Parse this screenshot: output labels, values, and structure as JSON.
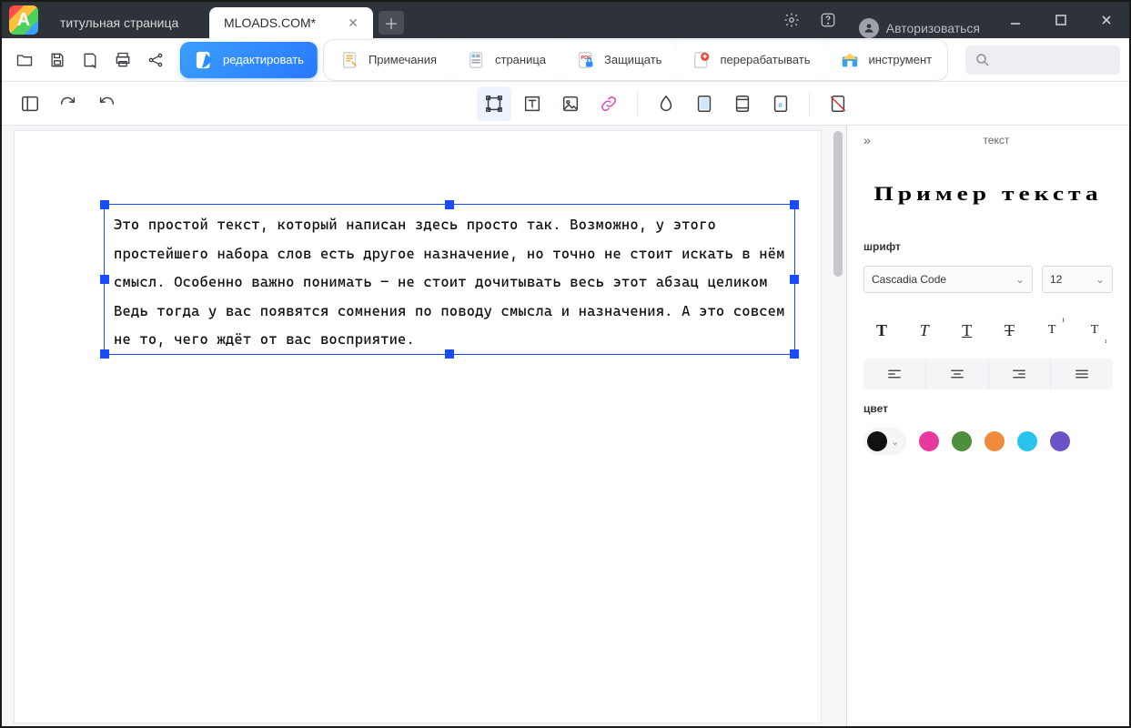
{
  "titlebar": {
    "tabs": [
      {
        "label": "титульная страница",
        "active": false
      },
      {
        "label": "MLOADS.COM*",
        "active": true
      }
    ],
    "auth_label": "Авторизоваться"
  },
  "ribbon": {
    "modes": {
      "edit": "редактировать",
      "notes": "Примечания",
      "page": "страница",
      "protect": "Защищать",
      "convert": "перерабатывать",
      "tools": "инструмент"
    },
    "search_placeholder": ""
  },
  "document": {
    "text": "Это простой текст, который написан здесь просто так. Возможно, у этого простейшего набора слов есть другое назначение, но точно не стоит искать в нём смысл. Особенно важно понимать – не стоит дочитывать весь этот абзац целиком Ведь тогда у вас появятся сомнения по поводу смысла и назначения. А это совсем не то, чего ждёт от вас восприятие."
  },
  "sidepanel": {
    "title": "текст",
    "sample": "Пример  текста",
    "sections": {
      "font": "шрифт",
      "color": "цвет"
    },
    "font_family": "Cascadia Code",
    "font_size": "12",
    "colors": [
      "#111111",
      "#e6399b",
      "#4e8f3d",
      "#f08a3c",
      "#29c3ee",
      "#6b52c7"
    ]
  }
}
